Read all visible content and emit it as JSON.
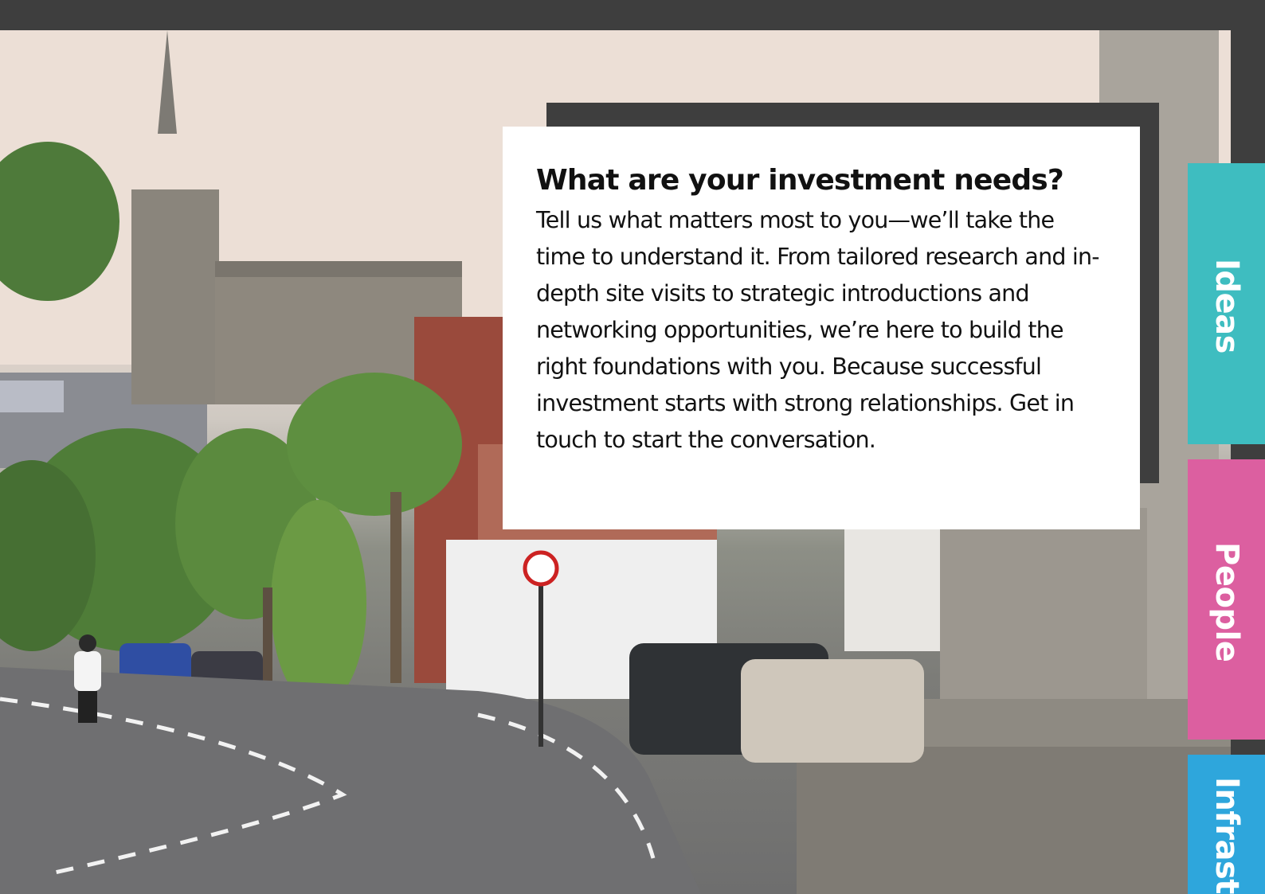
{
  "callout": {
    "heading": "What are your investment needs?",
    "body": "Tell us what matters most to you—we’ll take the time to understand it. From tailored research and in-depth site visits to strategic introductions and networking opportunities, we’re here to build the right foundations with you. Because successful investment starts with strong relationships. Get in touch to start the conversation."
  },
  "tabs": [
    {
      "label": "Ideas",
      "color": "#3ebdc0"
    },
    {
      "label": "People",
      "color": "#dc5fa0"
    },
    {
      "label": "Infrastr",
      "color": "#2ea6dc"
    }
  ],
  "photo": {
    "subject": "town-street-with-church"
  }
}
